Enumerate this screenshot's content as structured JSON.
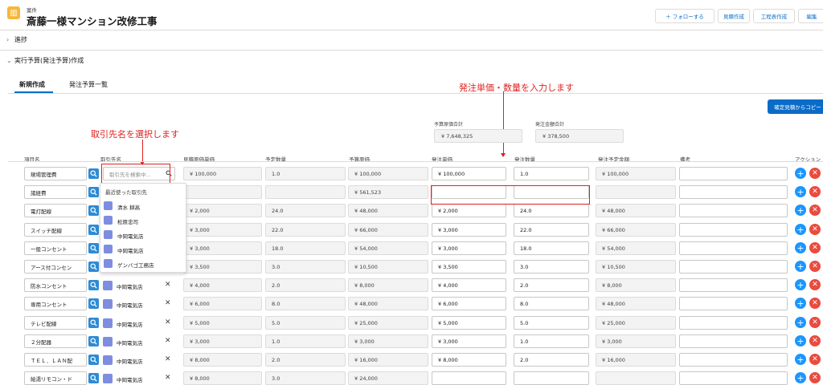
{
  "header": {
    "object_type": "案件",
    "title": "斎藤一様マンション改修工事",
    "follow_button": "＋ フォローする",
    "buttons": [
      "見積作成",
      "工程表作成",
      "編集"
    ]
  },
  "sections": {
    "progress": "進捗",
    "budget": "実行予算(発注予算)作成"
  },
  "tabs": [
    "新規作成",
    "発注予算一覧"
  ],
  "annotations": {
    "supplier": "取引先名を選択します",
    "price_qty": "発注単価・数量を入力します"
  },
  "copy_button": "確定見積からコピー",
  "summary": {
    "budget_total_label": "予算原価合計",
    "budget_total_value": "¥ 7,648,325",
    "order_total_label": "発注金額合計",
    "order_total_value": "¥ 378,500"
  },
  "columns": [
    "項目名",
    "取引先名",
    "見積原価単価",
    "予定数量",
    "予算原価",
    "発注単価",
    "発注数量",
    "発注予定金額",
    "備考",
    "アクション"
  ],
  "search": {
    "placeholder": "取引先を検索中..."
  },
  "dropdown": {
    "recent_label": "最近使った取引先",
    "items": [
      "清水 耕高",
      "松原忠司",
      "中岡電気店",
      "中岡電気店",
      "ゲンバゴ工務店"
    ]
  },
  "rows": [
    {
      "name": "現場管理費",
      "account": "",
      "est_unit": "¥ 100,000",
      "plan_qty": "1.0",
      "budget": "¥ 100,000",
      "order_unit": "¥ 100,000",
      "order_qty": "1.0",
      "order_amount": "¥ 100,000"
    },
    {
      "name": "諸経費",
      "account": "",
      "est_unit": "",
      "plan_qty": "",
      "budget": "¥ 561,523",
      "order_unit": "",
      "order_qty": "",
      "order_amount": ""
    },
    {
      "name": "電灯配線",
      "account": "",
      "est_unit": "¥ 2,000",
      "plan_qty": "24.0",
      "budget": "¥ 48,000",
      "order_unit": "¥ 2,000",
      "order_qty": "24.0",
      "order_amount": "¥ 48,000"
    },
    {
      "name": "スイッチ配線",
      "account": "",
      "est_unit": "¥ 3,000",
      "plan_qty": "22.0",
      "budget": "¥ 66,000",
      "order_unit": "¥ 3,000",
      "order_qty": "22.0",
      "order_amount": "¥ 66,000"
    },
    {
      "name": "一般コンセント",
      "account": "",
      "est_unit": "¥ 3,000",
      "plan_qty": "18.0",
      "budget": "¥ 54,000",
      "order_unit": "¥ 3,000",
      "order_qty": "18.0",
      "order_amount": "¥ 54,000"
    },
    {
      "name": "アース付コンセン",
      "account": "",
      "est_unit": "¥ 3,500",
      "plan_qty": "3.0",
      "budget": "¥ 10,500",
      "order_unit": "¥ 3,500",
      "order_qty": "3.0",
      "order_amount": "¥ 10,500"
    },
    {
      "name": "防水コンセント",
      "account": "中岡電気店",
      "est_unit": "¥ 4,000",
      "plan_qty": "2.0",
      "budget": "¥ 8,000",
      "order_unit": "¥ 4,000",
      "order_qty": "2.0",
      "order_amount": "¥ 8,000"
    },
    {
      "name": "専用コンセント",
      "account": "中岡電気店",
      "est_unit": "¥ 6,000",
      "plan_qty": "8.0",
      "budget": "¥ 48,000",
      "order_unit": "¥ 6,000",
      "order_qty": "8.0",
      "order_amount": "¥ 48,000"
    },
    {
      "name": "テレビ配線",
      "account": "中岡電気店",
      "est_unit": "¥ 5,000",
      "plan_qty": "5.0",
      "budget": "¥ 25,000",
      "order_unit": "¥ 5,000",
      "order_qty": "5.0",
      "order_amount": "¥ 25,000"
    },
    {
      "name": "２分配器",
      "account": "中岡電気店",
      "est_unit": "¥ 3,000",
      "plan_qty": "1.0",
      "budget": "¥ 3,000",
      "order_unit": "¥ 3,000",
      "order_qty": "1.0",
      "order_amount": "¥ 3,000"
    },
    {
      "name": "ＴＥＬ．ＬＡＮ配",
      "account": "中岡電気店",
      "est_unit": "¥ 8,000",
      "plan_qty": "2.0",
      "budget": "¥ 16,000",
      "order_unit": "¥ 8,000",
      "order_qty": "2.0",
      "order_amount": "¥ 16,000"
    },
    {
      "name": "給湯リモコン・ド",
      "account": "中岡電気店",
      "est_unit": "¥ 8,000",
      "plan_qty": "3.0",
      "budget": "¥ 24,000",
      "order_unit": "",
      "order_qty": "",
      "order_amount": ""
    }
  ]
}
